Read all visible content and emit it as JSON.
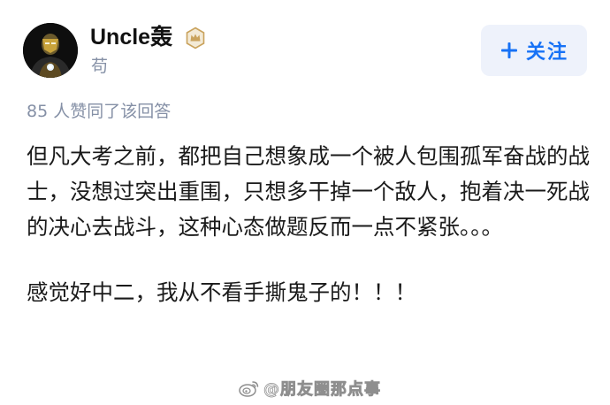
{
  "author": {
    "name": "Uncle轰",
    "subtitle": "苟",
    "avatar_icon": "iron-man-avatar-icon",
    "badge_icon": "crown-badge-icon"
  },
  "follow_button": {
    "icon": "plus-icon",
    "label": "关注"
  },
  "likes_text": "85 人赞同了该回答",
  "content": {
    "paragraphs": [
      "但凡大考之前，都把自己想象成一个被人包围孤军奋战的战士，没想过突出重围，只想多干掉一个敌人，抱着决一死战的决心去战斗，这种心态做题反而一点不紧张。。。",
      "感觉好中二，我从不看手撕鬼子的！！！"
    ]
  },
  "watermark": {
    "icon": "weibo-icon",
    "text": "@朋友圈那点事"
  },
  "colors": {
    "accent": "#1772f6",
    "button_bg": "#eef2fb",
    "muted_text": "#8590a6",
    "body_text": "#1a1a1a",
    "badge_gold": "#c9a25c"
  }
}
